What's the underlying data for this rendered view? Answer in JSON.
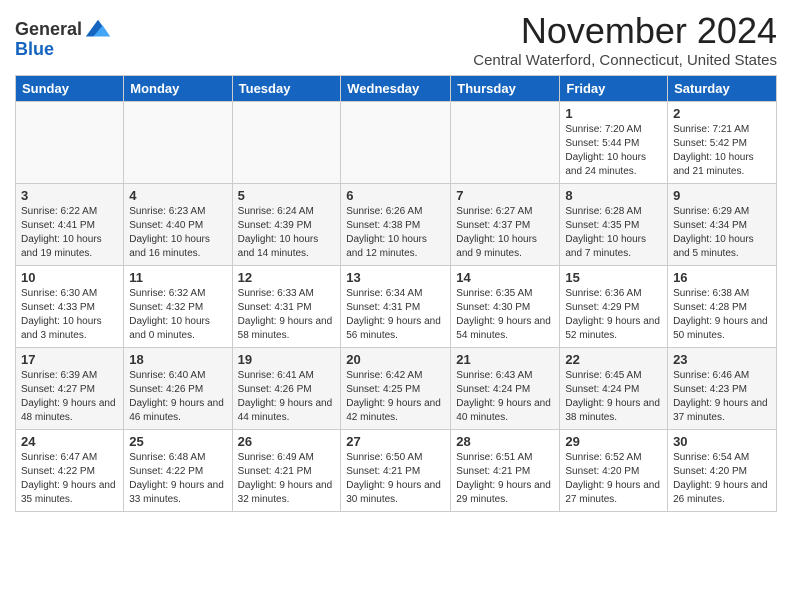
{
  "header": {
    "logo_general": "General",
    "logo_blue": "Blue",
    "month_title": "November 2024",
    "subtitle": "Central Waterford, Connecticut, United States"
  },
  "weekdays": [
    "Sunday",
    "Monday",
    "Tuesday",
    "Wednesday",
    "Thursday",
    "Friday",
    "Saturday"
  ],
  "weeks": [
    [
      {
        "day": "",
        "info": ""
      },
      {
        "day": "",
        "info": ""
      },
      {
        "day": "",
        "info": ""
      },
      {
        "day": "",
        "info": ""
      },
      {
        "day": "",
        "info": ""
      },
      {
        "day": "1",
        "info": "Sunrise: 7:20 AM\nSunset: 5:44 PM\nDaylight: 10 hours and 24 minutes."
      },
      {
        "day": "2",
        "info": "Sunrise: 7:21 AM\nSunset: 5:42 PM\nDaylight: 10 hours and 21 minutes."
      }
    ],
    [
      {
        "day": "3",
        "info": "Sunrise: 6:22 AM\nSunset: 4:41 PM\nDaylight: 10 hours and 19 minutes."
      },
      {
        "day": "4",
        "info": "Sunrise: 6:23 AM\nSunset: 4:40 PM\nDaylight: 10 hours and 16 minutes."
      },
      {
        "day": "5",
        "info": "Sunrise: 6:24 AM\nSunset: 4:39 PM\nDaylight: 10 hours and 14 minutes."
      },
      {
        "day": "6",
        "info": "Sunrise: 6:26 AM\nSunset: 4:38 PM\nDaylight: 10 hours and 12 minutes."
      },
      {
        "day": "7",
        "info": "Sunrise: 6:27 AM\nSunset: 4:37 PM\nDaylight: 10 hours and 9 minutes."
      },
      {
        "day": "8",
        "info": "Sunrise: 6:28 AM\nSunset: 4:35 PM\nDaylight: 10 hours and 7 minutes."
      },
      {
        "day": "9",
        "info": "Sunrise: 6:29 AM\nSunset: 4:34 PM\nDaylight: 10 hours and 5 minutes."
      }
    ],
    [
      {
        "day": "10",
        "info": "Sunrise: 6:30 AM\nSunset: 4:33 PM\nDaylight: 10 hours and 3 minutes."
      },
      {
        "day": "11",
        "info": "Sunrise: 6:32 AM\nSunset: 4:32 PM\nDaylight: 10 hours and 0 minutes."
      },
      {
        "day": "12",
        "info": "Sunrise: 6:33 AM\nSunset: 4:31 PM\nDaylight: 9 hours and 58 minutes."
      },
      {
        "day": "13",
        "info": "Sunrise: 6:34 AM\nSunset: 4:31 PM\nDaylight: 9 hours and 56 minutes."
      },
      {
        "day": "14",
        "info": "Sunrise: 6:35 AM\nSunset: 4:30 PM\nDaylight: 9 hours and 54 minutes."
      },
      {
        "day": "15",
        "info": "Sunrise: 6:36 AM\nSunset: 4:29 PM\nDaylight: 9 hours and 52 minutes."
      },
      {
        "day": "16",
        "info": "Sunrise: 6:38 AM\nSunset: 4:28 PM\nDaylight: 9 hours and 50 minutes."
      }
    ],
    [
      {
        "day": "17",
        "info": "Sunrise: 6:39 AM\nSunset: 4:27 PM\nDaylight: 9 hours and 48 minutes."
      },
      {
        "day": "18",
        "info": "Sunrise: 6:40 AM\nSunset: 4:26 PM\nDaylight: 9 hours and 46 minutes."
      },
      {
        "day": "19",
        "info": "Sunrise: 6:41 AM\nSunset: 4:26 PM\nDaylight: 9 hours and 44 minutes."
      },
      {
        "day": "20",
        "info": "Sunrise: 6:42 AM\nSunset: 4:25 PM\nDaylight: 9 hours and 42 minutes."
      },
      {
        "day": "21",
        "info": "Sunrise: 6:43 AM\nSunset: 4:24 PM\nDaylight: 9 hours and 40 minutes."
      },
      {
        "day": "22",
        "info": "Sunrise: 6:45 AM\nSunset: 4:24 PM\nDaylight: 9 hours and 38 minutes."
      },
      {
        "day": "23",
        "info": "Sunrise: 6:46 AM\nSunset: 4:23 PM\nDaylight: 9 hours and 37 minutes."
      }
    ],
    [
      {
        "day": "24",
        "info": "Sunrise: 6:47 AM\nSunset: 4:22 PM\nDaylight: 9 hours and 35 minutes."
      },
      {
        "day": "25",
        "info": "Sunrise: 6:48 AM\nSunset: 4:22 PM\nDaylight: 9 hours and 33 minutes."
      },
      {
        "day": "26",
        "info": "Sunrise: 6:49 AM\nSunset: 4:21 PM\nDaylight: 9 hours and 32 minutes."
      },
      {
        "day": "27",
        "info": "Sunrise: 6:50 AM\nSunset: 4:21 PM\nDaylight: 9 hours and 30 minutes."
      },
      {
        "day": "28",
        "info": "Sunrise: 6:51 AM\nSunset: 4:21 PM\nDaylight: 9 hours and 29 minutes."
      },
      {
        "day": "29",
        "info": "Sunrise: 6:52 AM\nSunset: 4:20 PM\nDaylight: 9 hours and 27 minutes."
      },
      {
        "day": "30",
        "info": "Sunrise: 6:54 AM\nSunset: 4:20 PM\nDaylight: 9 hours and 26 minutes."
      }
    ]
  ]
}
